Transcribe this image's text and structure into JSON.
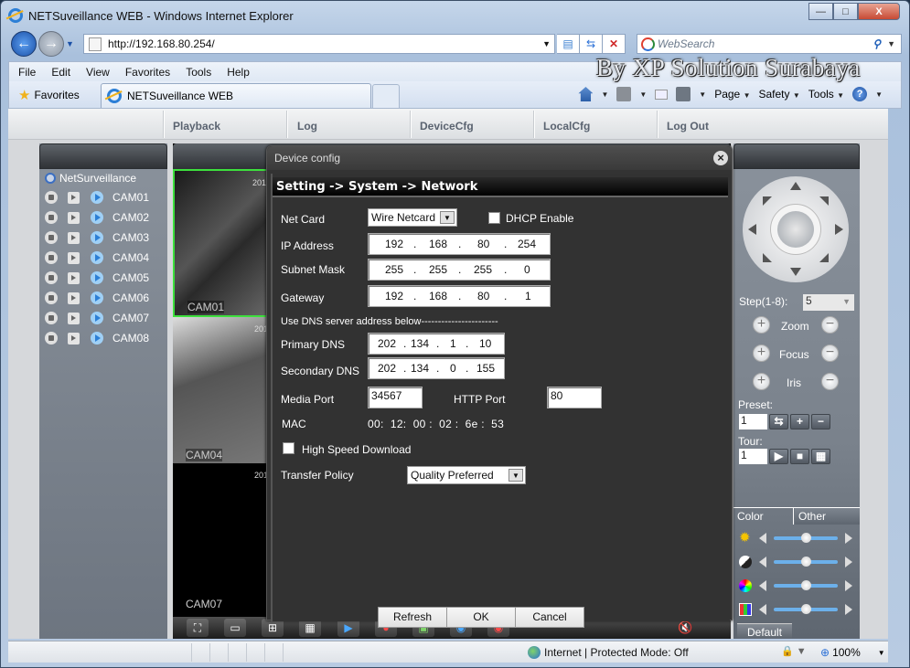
{
  "window": {
    "title": "NETSuveillance WEB - Windows Internet Explorer",
    "controls": {
      "minimize": "—",
      "maximize": "□",
      "close": "X"
    }
  },
  "browser": {
    "address": "http://192.168.80.254/",
    "search_placeholder": "WebSearch",
    "menu": [
      "File",
      "Edit",
      "View",
      "Favorites",
      "Tools",
      "Help"
    ],
    "favorites_label": "Favorites",
    "tab_title": "NETSuveillance WEB",
    "command_bar": {
      "page": "Page",
      "safety": "Safety",
      "tools": "Tools"
    },
    "watermark": "By XP Solution Surabaya",
    "status": {
      "zone": "Internet | Protected Mode: Off",
      "zoom": "100%"
    }
  },
  "app": {
    "nav": [
      "Playback",
      "Log",
      "DeviceCfg",
      "LocalCfg",
      "Log Out"
    ],
    "tree": {
      "root": "NetSurveillance",
      "cameras": [
        "CAM01",
        "CAM02",
        "CAM03",
        "CAM04",
        "CAM05",
        "CAM06",
        "CAM07",
        "CAM08"
      ]
    },
    "video": {
      "cells": [
        {
          "label": "CAM01",
          "timestamp": "201"
        },
        {
          "label": "CAM04",
          "timestamp": "201"
        },
        {
          "label": "CAM07",
          "timestamp": "201"
        }
      ]
    },
    "ptz": {
      "step_label": "Step(1-8):",
      "step_value": "5",
      "zoom_label": "Zoom",
      "focus_label": "Focus",
      "iris_label": "Iris",
      "preset_label": "Preset:",
      "preset_value": "1",
      "tour_label": "Tour:",
      "tour_value": "1"
    },
    "color_tabs": [
      "Color",
      "Other"
    ],
    "color_sliders": [
      {
        "name": "brightness",
        "value": 0.5
      },
      {
        "name": "contrast",
        "value": 0.5
      },
      {
        "name": "saturation",
        "value": 0.5
      },
      {
        "name": "hue",
        "value": 0.5
      }
    ],
    "default_button": "Default"
  },
  "dialog": {
    "title": "Device config",
    "breadcrumb": "Setting -> System -> Network",
    "net_card_label": "Net Card",
    "net_card_value": "Wire Netcard",
    "dhcp_label": "DHCP Enable",
    "dhcp_checked": false,
    "ip_label": "IP Address",
    "ip": [
      "192",
      "168",
      "80",
      "254"
    ],
    "subnet_label": "Subnet Mask",
    "subnet": [
      "255",
      "255",
      "255",
      "0"
    ],
    "gateway_label": "Gateway",
    "gateway": [
      "192",
      "168",
      "80",
      "1"
    ],
    "dns_heading": "Use DNS server address below-----------------------",
    "primary_dns_label": "Primary DNS",
    "primary_dns": [
      "202",
      "134",
      "1",
      "10"
    ],
    "secondary_dns_label": "Secondary DNS",
    "secondary_dns": [
      "202",
      "134",
      "0",
      "155"
    ],
    "media_port_label": "Media Port",
    "media_port": "34567",
    "http_port_label": "HTTP Port",
    "http_port": "80",
    "mac_label": "MAC",
    "mac": "00:  12:  00 :  02 :  6e :  53",
    "high_speed_label": "High Speed Download",
    "high_speed_checked": false,
    "transfer_label": "Transfer Policy",
    "transfer_value": "Quality Preferred",
    "buttons": {
      "refresh": "Refresh",
      "ok": "OK",
      "cancel": "Cancel"
    }
  }
}
